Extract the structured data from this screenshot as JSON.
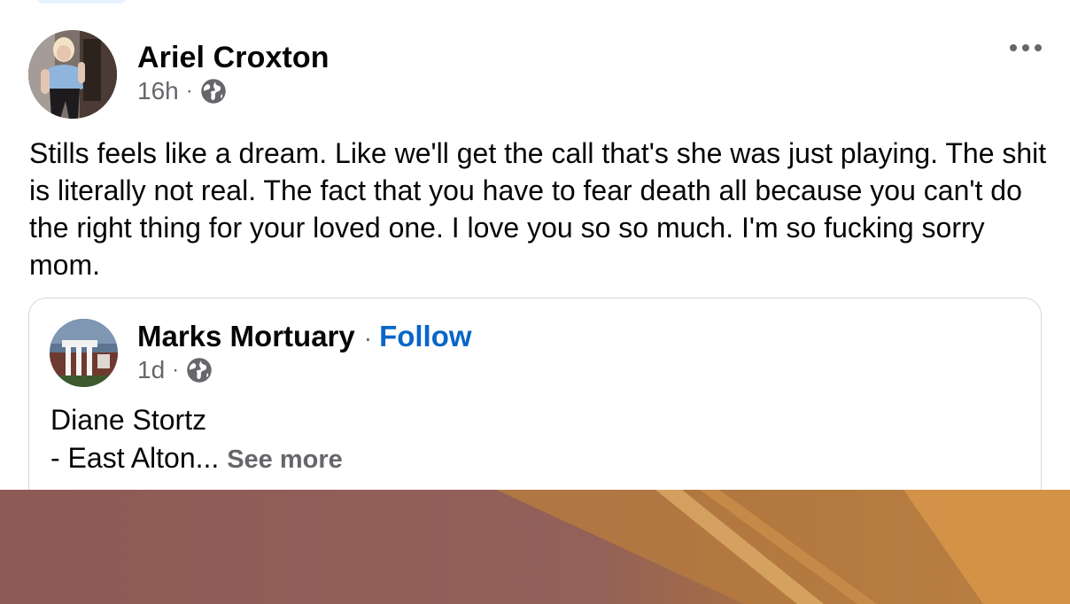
{
  "post": {
    "author_name": "Ariel Croxton",
    "time": "16h",
    "separator": "·",
    "privacy_icon": "globe-icon",
    "more_icon": "more-options-icon",
    "text": "Stills feels like a dream. Like we'll get the call that's she was just playing. The shit is literally not real. The fact that you have to fear death all because you can't do the right thing for your loved one. I love you so so much. I'm so fucking sorry mom."
  },
  "shared": {
    "page_name": "Marks Mortuary",
    "separator": "·",
    "follow_label": "Follow",
    "time": "1d",
    "privacy_icon": "globe-icon",
    "line1": "Diane Stortz",
    "line2": "- East Alton...",
    "see_more": "See more"
  },
  "colors": {
    "text_primary": "#050505",
    "text_secondary": "#65676b",
    "link_blue": "#0866c6",
    "card_border": "#d6d8dc"
  }
}
